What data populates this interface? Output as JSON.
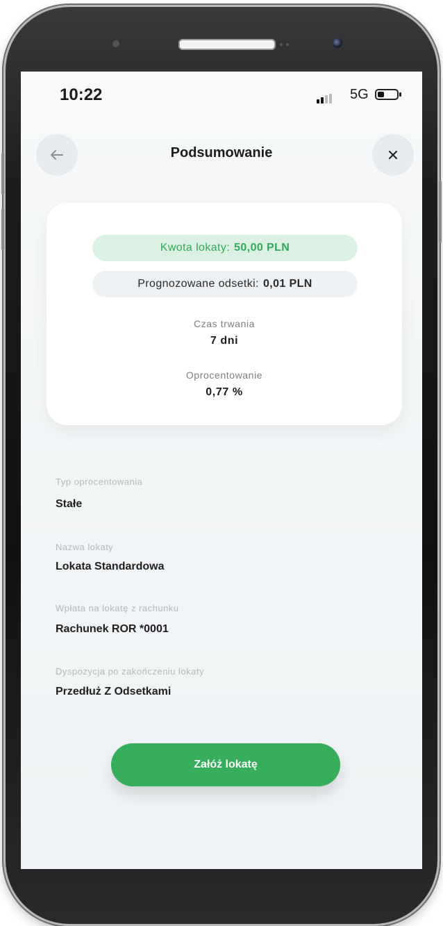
{
  "status_bar": {
    "time": "10:22",
    "network": "5G"
  },
  "nav": {
    "title": "Podsumowanie"
  },
  "icons": {
    "back": "arrow-left-icon",
    "close": "close-icon",
    "signal": "signal-strength-icon",
    "battery": "battery-icon"
  },
  "summary": {
    "amount_label": "Kwota lokaty:",
    "amount_value": "50,00 PLN",
    "interest_label": "Prognozowane odsetki:",
    "interest_value": "0,01 PLN",
    "duration_label": "Czas trwania",
    "duration_value": "7 dni",
    "rate_label": "Oprocentowanie",
    "rate_value": "0,77 %"
  },
  "details": [
    {
      "label": "Typ oprocentowania",
      "value": "Stałe"
    },
    {
      "label": "Nazwa lokaty",
      "value": "Lokata Standardowa"
    },
    {
      "label": "Wpłata na lokatę z rachunku",
      "value": "Rachunek ROR *0001"
    },
    {
      "label": "Dyspozycja po zakończeniu lokaty",
      "value": "Przedłuż Z Odsetkami"
    }
  ],
  "actions": {
    "submit_label": "Załóż lokatę"
  },
  "colors": {
    "accent": "#36ae5a",
    "accent_light": "#dbf1e3",
    "background": "#eef2f4"
  }
}
